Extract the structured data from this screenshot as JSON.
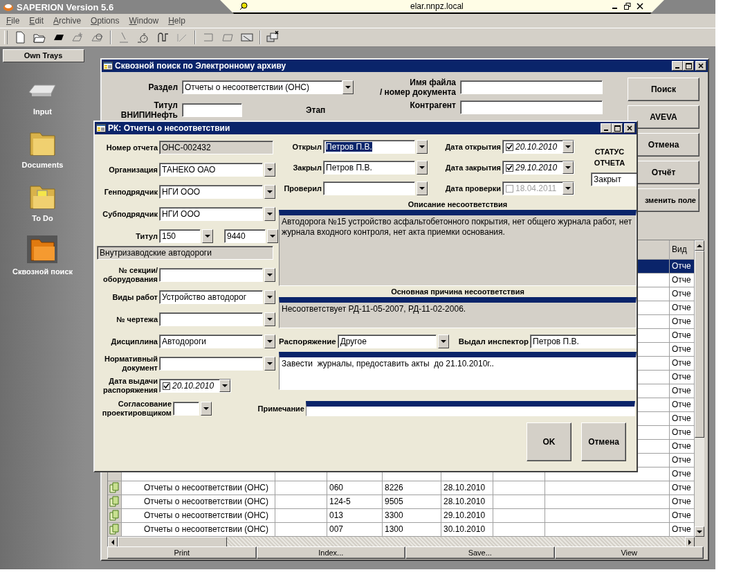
{
  "app": {
    "title": "SAPERION Version 5.6",
    "host": "elar.nnpz.local",
    "menu": [
      {
        "label": "File"
      },
      {
        "label": "Edit"
      },
      {
        "label": "Archive"
      },
      {
        "label": "Options"
      },
      {
        "label": "Window"
      },
      {
        "label": "Help"
      }
    ]
  },
  "sidebar": {
    "title": "Own Trays",
    "items": [
      {
        "label": "Input"
      },
      {
        "label": "Documents"
      },
      {
        "label": "To Do"
      },
      {
        "label": "Сквозной поиск"
      }
    ]
  },
  "search_window": {
    "title": "Сквозной поиск по Электронному архиву",
    "section": {
      "label": "Раздел",
      "value": "Отчеты о несоответствии (ОНС)"
    },
    "file_name": {
      "label": "Имя файла\n/ номер документа"
    },
    "title_field": {
      "label": "Титул\nВНИПИНефть"
    },
    "stage": {
      "label": "Этап"
    },
    "counterparty": {
      "label": "Контрагент"
    },
    "buttons": [
      "Поиск",
      "AVEVA",
      "Отмена",
      "Отчёт",
      "зменить поле"
    ],
    "table": {
      "column_9_header": "Вид",
      "rows": [
        {
          "selected": true,
          "column_9": "Отче"
        },
        {
          "selected": false,
          "column_9": "Отче"
        },
        {
          "selected": false,
          "column_9": "Отче"
        },
        {
          "selected": false,
          "column_9": "Отче"
        },
        {
          "selected": false,
          "column_9": "Отче"
        },
        {
          "selected": false,
          "column_9": "Отче"
        },
        {
          "selected": false,
          "column_9": "Отче"
        },
        {
          "selected": false,
          "column_9": "Отче"
        },
        {
          "selected": false,
          "column_9": "Отче"
        },
        {
          "selected": false,
          "column_9": "Отче"
        },
        {
          "selected": false,
          "column_9": "Отче"
        },
        {
          "selected": false,
          "column_9": "Отче"
        },
        {
          "selected": false,
          "column_9": "Отче"
        },
        {
          "selected": false,
          "column_9": "Отче"
        },
        {
          "selected": false,
          "column_9": "Отче"
        },
        {
          "selected": false,
          "column_9": "Отче"
        },
        {
          "selected": false,
          "column_2": "Отчеты о несоответствии (ОНС)",
          "column_4": "060",
          "column_5": "8226",
          "column_6": "28.10.2010",
          "column_9": "Отче"
        },
        {
          "selected": false,
          "column_2": "Отчеты о несоответствии (ОНС)",
          "column_4": "124-5",
          "column_5": "9505",
          "column_6": "28.10.2010",
          "column_9": "Отче"
        },
        {
          "selected": false,
          "column_2": "Отчеты о несоответствии (ОНС)",
          "column_4": "013",
          "column_5": "3300",
          "column_6": "29.10.2010",
          "column_9": "Отче"
        },
        {
          "selected": false,
          "column_2": "Отчеты о несоответствии (ОНС)",
          "column_4": "007",
          "column_5": "1300",
          "column_6": "30.10.2010",
          "column_9": "Отче"
        }
      ]
    },
    "footer_buttons": [
      "Print",
      "Index...",
      "Save...",
      "View"
    ]
  },
  "dialog": {
    "title": "РК: Отчеты о несоответствии",
    "left_fields": [
      {
        "kind": "readonly",
        "label": "Номер отчета",
        "value": "ОНС-002432"
      },
      {
        "kind": "select",
        "label": "Организация",
        "value": "ТАНЕКО ОАО"
      },
      {
        "kind": "select",
        "label": "Генподрядчик",
        "value": "НГИ ООО"
      },
      {
        "kind": "select",
        "label": "Субподрядчик",
        "value": "НГИ ООО"
      },
      {
        "kind": "pair",
        "label": "Титул",
        "value": "150",
        "value2": "9440"
      },
      {
        "kind": "note",
        "value": "Внутризаводские автодороги"
      },
      {
        "kind": "select",
        "label": "№ секции/\nоборудования"
      },
      {
        "kind": "select",
        "label": "Виды работ",
        "value": "Устройство автодорог"
      },
      {
        "kind": "select",
        "label": "№ чертежа"
      },
      {
        "kind": "select",
        "label": "Дисциплина",
        "value": "Автодороги"
      },
      {
        "kind": "select",
        "label": "Нормативный\nдокумент"
      },
      {
        "kind": "date",
        "label": "Дата выдачи\nраспоряжения",
        "value": "20.10.2010",
        "checked": true
      }
    ],
    "people": [
      {
        "label": "Открыл",
        "value": "Петров П.В.",
        "text_selected": true
      },
      {
        "label": "Закрыл",
        "value": "Петров П.В.",
        "text_selected": false
      },
      {
        "label": "Проверил"
      }
    ],
    "dates": [
      {
        "label": "Дата открытия",
        "value": "20.10.2010",
        "checked": true,
        "disabled": false
      },
      {
        "label": "Дата закрытия",
        "value": "29.10.2010",
        "checked": true,
        "disabled": false
      },
      {
        "label": "Дата проверки",
        "value": "18.04.2011",
        "checked": false,
        "disabled": true
      }
    ],
    "status": {
      "label": "СТАТУС ОТЧЕТА",
      "value": "Закрыт"
    },
    "description": {
      "heading": "Описание несоответствия",
      "text": "Автодорога №15 устройство асфальтобетонного покрытия, нет общего журнала работ, нет журнала входного контроля, нет акта приемки основания.",
      "readonly": true
    },
    "cause": {
      "heading": "Основная причина несоответствия",
      "text": "Несоответствует РД-11-05-2007, РД-11-02-2006.",
      "readonly": true
    },
    "order": {
      "label": "Распоряжение",
      "value": "Другое",
      "inspector_label": "Выдал инспектор",
      "inspector": "Петров П.В.",
      "text": "Завести  журналы, предоставить акты  до 21.10.2010г..",
      "readonly": false
    },
    "approval": {
      "label": "Согласование\nпроектировщиком"
    },
    "note": {
      "label": "Примечание"
    },
    "buttons": [
      "OK",
      "Отмена"
    ]
  }
}
